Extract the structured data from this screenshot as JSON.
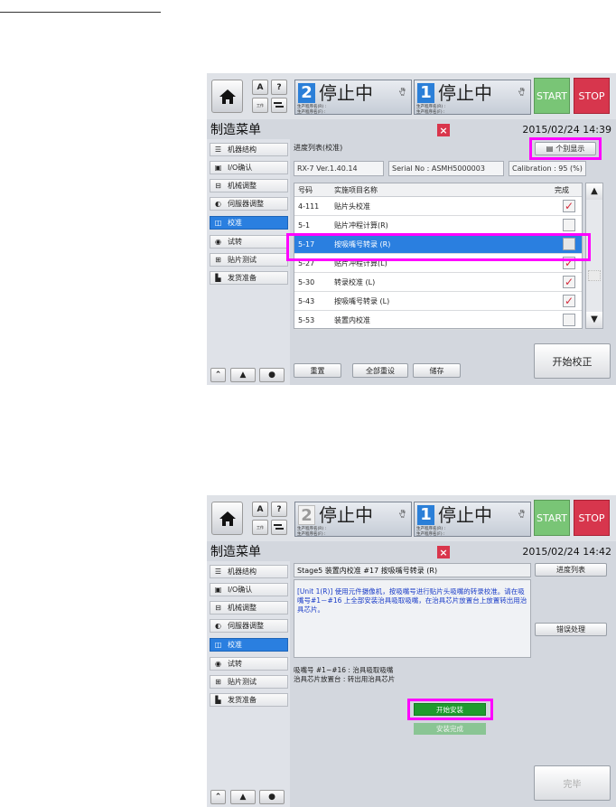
{
  "screens": [
    {
      "header": {
        "stage1": {
          "num": "2",
          "status": "停止中",
          "line1": "生产程序名(R) :",
          "line2": "生产程序名(F) :"
        },
        "stage2": {
          "num": "1",
          "status": "停止中",
          "line1": "生产程序名(R) :",
          "line2": "生产程序名(F) :"
        },
        "start": "START",
        "stop": "STOP",
        "help": "?",
        "small_a": "A",
        "small_b": "工作",
        "small_c": "工作"
      },
      "title": "制造菜单",
      "close": "×",
      "datetime": "2015/02/24 14:39",
      "sidebar": [
        "机器结构",
        "I/O确认",
        "机械调整",
        "伺服器调整",
        "校准",
        "试转",
        "贴片测试",
        "发货准备"
      ],
      "sidebar_selected": 4,
      "progress_label": "进度列表(校准)",
      "individual_button": "个别显示",
      "version": "RX-7 Ver.1.40.14",
      "serial": "Serial No : ASMH5000003",
      "calibration": "Calibration : 95 (%)",
      "table": {
        "headers": [
          "号码",
          "实施项目名称",
          "完成"
        ],
        "rows": [
          {
            "code": "4-111",
            "name": "贴片头校准",
            "done": true
          },
          {
            "code": "5-1",
            "name": "贴片冲程计算(R)",
            "done": false
          },
          {
            "code": "5-17",
            "name": "按吸嘴号转录 (R)",
            "done": false
          },
          {
            "code": "5-27",
            "name": "贴片冲程计算(L)",
            "done": true
          },
          {
            "code": "5-30",
            "name": "转录校准 (L)",
            "done": true
          },
          {
            "code": "5-43",
            "name": "按吸嘴号转录 (L)",
            "done": true
          },
          {
            "code": "5-53",
            "name": "装置内校准",
            "done": false
          }
        ],
        "selected_row": 2
      },
      "buttons": {
        "reset": "重置",
        "reset_all": "全部重设",
        "save": "储存",
        "start_calib": "开始校正"
      }
    },
    {
      "header": {
        "stage1": {
          "num": "2",
          "status": "停止中",
          "line1": "生产程序名(R) :",
          "line2": "生产程序名(F) :"
        },
        "stage2": {
          "num": "1",
          "status": "停止中",
          "line1": "生产程序名(R) :",
          "line2": "生产程序名(F) :"
        },
        "start": "START",
        "stop": "STOP",
        "help": "?",
        "small_a": "A",
        "small_b": "工作",
        "small_c": "工作"
      },
      "title": "制造菜单",
      "close": "×",
      "datetime": "2015/02/24 14:42",
      "sidebar": [
        "机器结构",
        "I/O确认",
        "机械调整",
        "伺服器调整",
        "校准",
        "试转",
        "贴片测试",
        "发货准备"
      ],
      "sidebar_selected": 4,
      "step_title": "Stage5 装置内校准 #17 按吸嘴号转录 (R)",
      "progress_list_button": "进度列表",
      "info_text": "[Unit 1(R)] 使用元件摄像机，按吸嘴号进行贴片头吸嘴的转录校准。请在吸嘴号#1－#16 上全部安装治具吸取吸嘴，在治具芯片放置台上放置转出用治具芯片。",
      "error_button": "错误处理",
      "desc1": "吸嘴号 #1~#16 : 治具吸取吸嘴",
      "desc2": "治具芯片放置台 : 转出用治具芯片",
      "start_install": "开始安装",
      "install_done": "安装完成",
      "finish": "完毕"
    }
  ]
}
